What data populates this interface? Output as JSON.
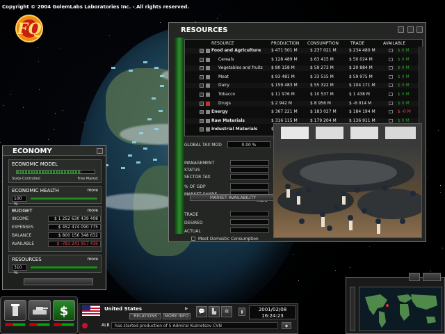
{
  "copyright": "Copyright © 2004 GolemLabs Laboratories Inc. - All rights reserved.",
  "logo_text": "FQ",
  "resources": {
    "title": "RESOURCES",
    "headers": {
      "resource": "RESOURCE",
      "production": "PRODUCTION",
      "consumption": "CONSUMPTION",
      "trade": "TRADE",
      "available": "AVAILABLE"
    },
    "rows": [
      {
        "name": "Food and Agriculture",
        "production": "$ 471 501 M",
        "consumption": "$ 237 021 M",
        "trade": "$ 234 480 M",
        "available": "$ 0 M",
        "category": true
      },
      {
        "name": "Cereals",
        "production": "$ 128 489 M",
        "consumption": "$ 63 415 M",
        "trade": "$ 50 024 M",
        "available": "$ 0 M",
        "category": false
      },
      {
        "name": "Vegetables and fruits",
        "production": "$ 80 158 M",
        "consumption": "$ 59 273 M",
        "trade": "$ 20 884 M",
        "available": "$ 0 M",
        "category": false
      },
      {
        "name": "Meat",
        "production": "$ 93 481 M",
        "consumption": "$ 33 515 M",
        "trade": "$ 59 975 M",
        "available": "$ 0 M",
        "category": false
      },
      {
        "name": "Dairy",
        "production": "$ 159 483 M",
        "consumption": "$ 55 322 M",
        "trade": "$ 104 171 M",
        "available": "$ 0 M",
        "category": false
      },
      {
        "name": "Tobacco",
        "production": "$ 11 976 M",
        "consumption": "$ 10 537 M",
        "trade": "$ 1 438 M",
        "available": "$ 0 M",
        "category": false
      },
      {
        "name": "Drugs",
        "production": "$ 2 942 M",
        "consumption": "$ 8 956 M",
        "trade": "$ -6 014 M",
        "available": "$ 0 M",
        "category": false,
        "drug": true
      },
      {
        "name": "Energy",
        "production": "$ 367 221 M",
        "consumption": "$ 183 027 M",
        "trade": "$ 184 194 M",
        "available": "$ -0 M",
        "category": true
      },
      {
        "name": "Raw Materials",
        "production": "$ 316 115 M",
        "consumption": "$ 179 204 M",
        "trade": "$ 136 911 M",
        "available": "$ 0 M",
        "category": true
      },
      {
        "name": "Industrial Materials",
        "production": "$ 492 605 M",
        "consumption": "$ 333 611 M",
        "trade": "$ 158 994 M",
        "available": "$ -0 M",
        "category": true
      }
    ],
    "global_tax_label": "GLOBAL TAX MOD",
    "global_tax_value": "0.00 %",
    "management_label": "MANAGEMENT",
    "status_label": "STATUS",
    "sector_tax_label": "SECTOR TAX",
    "gdp_label": "% OF GDP",
    "market_share_label": "MARKET SHARE",
    "more_label": "more",
    "market_availability_label": "MARKET AVAILABILITY",
    "trade_label": "TRADE",
    "desired_label": "DESIRED",
    "actual_label": "ACTUAL",
    "meet_consumption_label": "Meet Domestic Consumption"
  },
  "economy": {
    "title": "ECONOMY",
    "model_title": "ECONOMIC MODEL",
    "left_label": "State-Controlled",
    "right_label": "Free Market",
    "model_position": 0.83,
    "health_title": "ECONOMIC HEALTH",
    "health_value": "100 %",
    "health_fraction": 1.0,
    "budget_title": "BUDGET",
    "more_label": "more",
    "budget_rows": [
      {
        "label": "INCOME",
        "value": "$ 1 252 630 439 408",
        "negative": false
      },
      {
        "label": "EXPENSES",
        "value": "$ 452 474 090 775",
        "negative": false
      },
      {
        "label": "BALANCE",
        "value": "$ 800 156 348 632",
        "negative": false
      },
      {
        "label": "AVAILABLE",
        "value": "$ -783 241 957 436",
        "negative": true
      }
    ],
    "resources_title": "RESOURCES",
    "resources_value": "310 %",
    "resources_fraction": 1.0
  },
  "bottom": {
    "country": "United States",
    "relations_label": "RELATIONS",
    "more_info_label": "MORE INFO",
    "date": "2001/02/08",
    "time": "16:24:23",
    "country_code": "ALB",
    "news": "has started production of 5 Admiral Kuznetsov CVN"
  },
  "colors": {
    "accent_green": "#2e9e2e",
    "negative_red": "#ff4040",
    "panel_bg": "#1e201e"
  }
}
